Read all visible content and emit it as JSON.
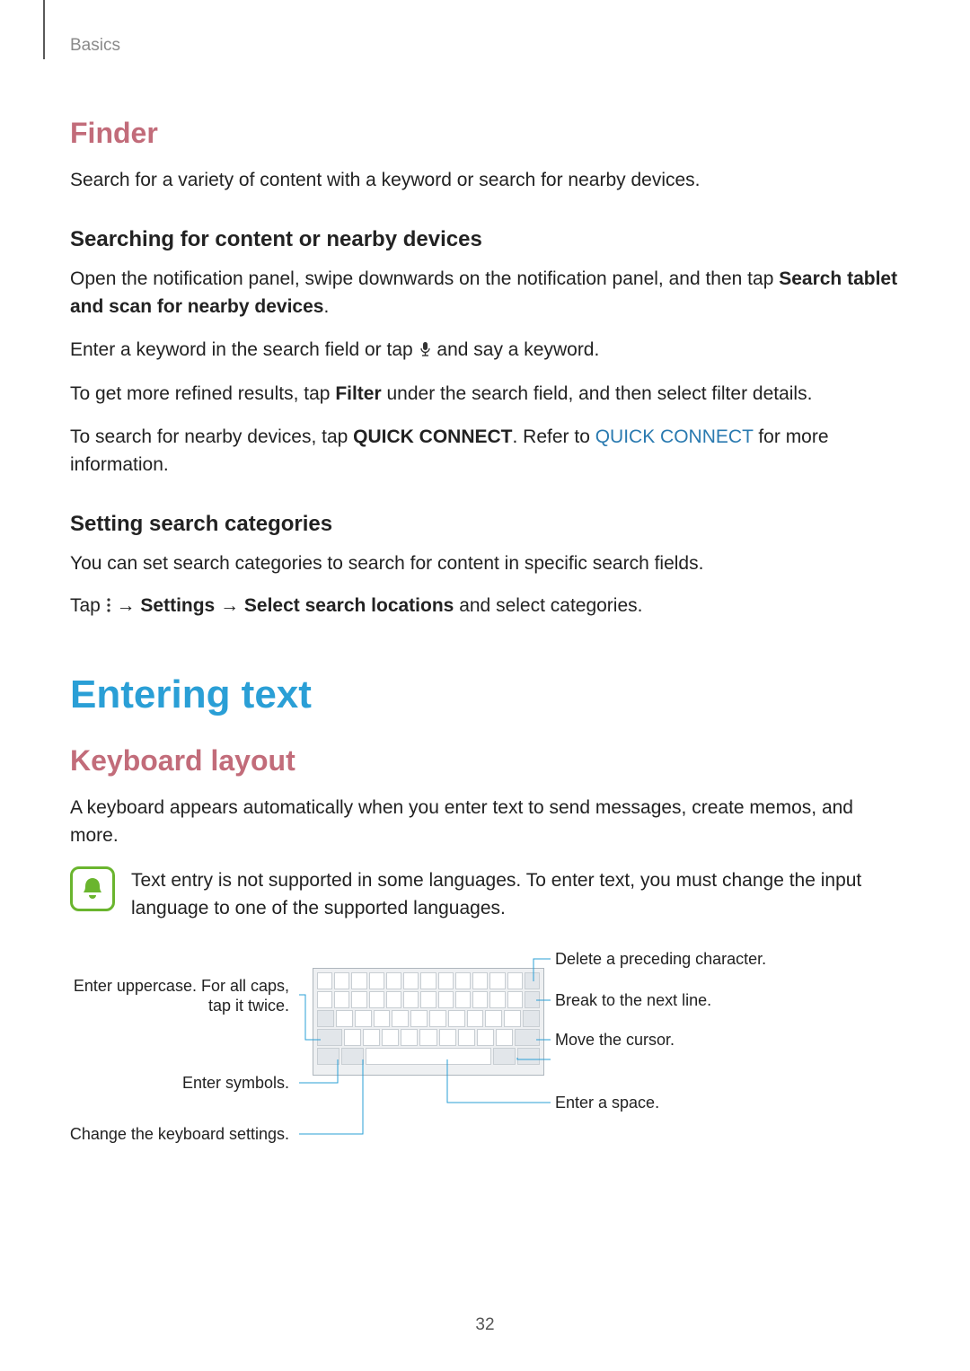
{
  "breadcrumb": "Basics",
  "s1": {
    "title": "Finder",
    "intro": "Search for a variety of content with a keyword or search for nearby devices.",
    "h_a": "Searching for content or nearby devices",
    "p1_a": "Open the notification panel, swipe downwards on the notification panel, and then tap ",
    "p1_b": "Search tablet and scan for nearby devices",
    "p1_c": ".",
    "p2_a": "Enter a keyword in the search field or tap ",
    "p2_b": " and say a keyword.",
    "p3_a": "To get more refined results, tap ",
    "p3_b": "Filter",
    "p3_c": " under the search field, and then select filter details.",
    "p4_a": "To search for nearby devices, tap ",
    "p4_b": "QUICK CONNECT",
    "p4_c": ". Refer to ",
    "p4_link": "QUICK CONNECT",
    "p4_d": " for more information.",
    "h_b": "Setting search categories",
    "p5": "You can set search categories to search for content in specific search fields.",
    "p6_a": "Tap ",
    "p6_b": " → ",
    "p6_c": "Settings",
    "p6_d": " → ",
    "p6_e": "Select search locations",
    "p6_f": " and select categories."
  },
  "s2": {
    "title": "Entering text",
    "h_a": "Keyboard layout",
    "intro": "A keyboard appears automatically when you enter text to send messages, create memos, and more.",
    "note": "Text entry is not supported in some languages. To enter text, you must change the input language to one of the supported languages."
  },
  "labels": {
    "l_caps_a": "Enter uppercase. For all caps,",
    "l_caps_b": "tap it twice.",
    "l_sym": "Enter symbols.",
    "l_set": "Change the keyboard settings.",
    "r_del": "Delete a preceding character.",
    "r_brk": "Break to the next line.",
    "r_cur": "Move the cursor.",
    "r_spc": "Enter a space."
  },
  "page": "32"
}
